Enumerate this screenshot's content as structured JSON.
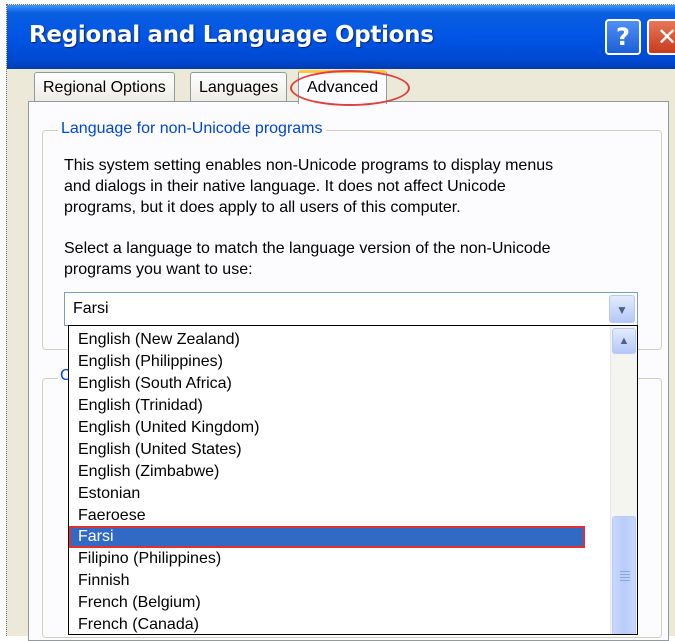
{
  "window": {
    "title": "Regional and Language Options",
    "help_label": "?",
    "close_label": "✕"
  },
  "tabs": [
    {
      "label": "Regional Options",
      "active": false
    },
    {
      "label": "Languages",
      "active": false
    },
    {
      "label": "Advanced",
      "active": true
    }
  ],
  "group": {
    "legend": "Language for non-Unicode programs",
    "desc_lines": [
      "This system setting enables non-Unicode programs to display menus",
      "and dialogs in their native language. It does not affect Unicode",
      "programs, but it does apply to all users of this computer."
    ],
    "select_lines": [
      "Select a language to match the language version of the non-Unicode",
      "programs you want to use:"
    ]
  },
  "language_combo": {
    "value": "Farsi",
    "arrow_icon": "chevron-down-icon"
  },
  "group2": {
    "legend_partial": "C"
  },
  "dropdown": {
    "items": [
      "English (New Zealand)",
      "English (Philippines)",
      "English (South Africa)",
      "English (Trinidad)",
      "English (United Kingdom)",
      "English (United States)",
      "English (Zimbabwe)",
      "Estonian",
      "Faeroese",
      "Farsi",
      "Filipino (Philippines)",
      "Finnish",
      "French (Belgium)",
      "French (Canada)"
    ],
    "selected": "Farsi"
  },
  "colors": {
    "selection": "#316ac5",
    "highlight_outline": "#e03030",
    "group_legend": "#0046d5",
    "title_bar": "#0055e5"
  }
}
